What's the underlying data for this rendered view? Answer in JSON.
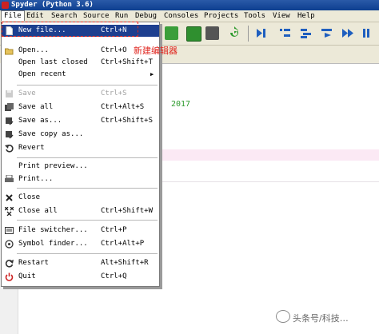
{
  "window": {
    "title": "Spyder (Python 3.6)"
  },
  "menubar": {
    "items": [
      "File",
      "Edit",
      "Search",
      "Source",
      "Run",
      "Debug",
      "Consoles",
      "Projects",
      "Tools",
      "View",
      "Help"
    ],
    "active": "File"
  },
  "toolbar": {
    "icons": [
      "run-cell-icon",
      "run-cell-advance-icon",
      "run-selection-icon",
      "step-into-icon",
      "continue-icon",
      "debug-icon",
      "step-icon",
      "step-return-icon",
      "continue-debug-icon",
      "stop-debug-icon"
    ]
  },
  "editor": {
    "visible_text": "2017"
  },
  "file_menu": {
    "items": [
      {
        "label": "New file...",
        "shortcut": "Ctrl+N",
        "icon": "new-file-icon",
        "highlighted": true
      },
      {
        "label": "Open...",
        "shortcut": "Ctrl+O",
        "icon": "open-folder-icon"
      },
      {
        "label": "Open last closed",
        "shortcut": "Ctrl+Shift+T",
        "icon": ""
      },
      {
        "label": "Open recent",
        "shortcut": "",
        "icon": "",
        "submenu": true
      },
      {
        "label": "Save",
        "shortcut": "Ctrl+S",
        "icon": "save-icon",
        "disabled": true
      },
      {
        "label": "Save all",
        "shortcut": "Ctrl+Alt+S",
        "icon": "save-all-icon"
      },
      {
        "label": "Save as...",
        "shortcut": "Ctrl+Shift+S",
        "icon": "save-as-icon"
      },
      {
        "label": "Save copy as...",
        "shortcut": "",
        "icon": "save-copy-icon"
      },
      {
        "label": "Revert",
        "shortcut": "",
        "icon": "revert-icon"
      },
      {
        "label": "Print preview...",
        "shortcut": "",
        "icon": ""
      },
      {
        "label": "Print...",
        "shortcut": "",
        "icon": "print-icon"
      },
      {
        "label": "Close",
        "shortcut": "",
        "icon": "close-icon"
      },
      {
        "label": "Close all",
        "shortcut": "Ctrl+Shift+W",
        "icon": "close-all-icon"
      },
      {
        "label": "File switcher...",
        "shortcut": "Ctrl+P",
        "icon": "file-switcher-icon"
      },
      {
        "label": "Symbol finder...",
        "shortcut": "Ctrl+Alt+P",
        "icon": "symbol-finder-icon"
      },
      {
        "label": "Restart",
        "shortcut": "Alt+Shift+R",
        "icon": "restart-icon"
      },
      {
        "label": "Quit",
        "shortcut": "Ctrl+Q",
        "icon": "quit-icon"
      }
    ]
  },
  "annotation": {
    "text": "新建编辑器"
  },
  "watermark": {
    "text": "头条号/科技…"
  },
  "colors": {
    "highlight": "#1d3f8f",
    "annotation": "#e0261f",
    "date_text": "#2e9b2e"
  }
}
